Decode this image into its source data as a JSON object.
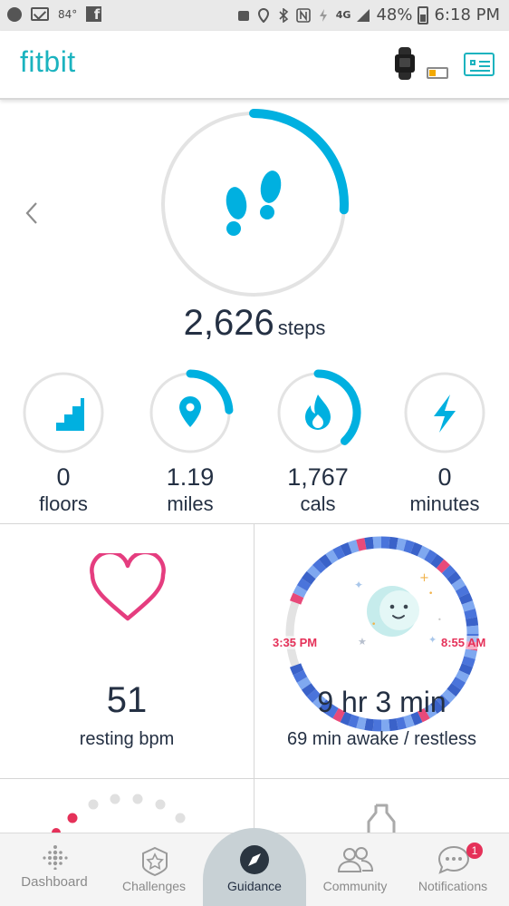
{
  "status_bar": {
    "temperature": "84°",
    "network": "4G",
    "battery": "48%",
    "time": "6:18 PM"
  },
  "header": {
    "logo": "fitbit"
  },
  "steps": {
    "value": "2,626",
    "unit": "steps",
    "progress": 0.26
  },
  "stats": [
    {
      "id": "floors",
      "value": "0",
      "label": "floors",
      "icon": "stairs-icon",
      "progress": 0
    },
    {
      "id": "miles",
      "value": "1.19",
      "label": "miles",
      "icon": "location-pin-icon",
      "progress": 0.24
    },
    {
      "id": "cals",
      "value": "1,767",
      "label": "cals",
      "icon": "flame-icon",
      "progress": 0.38
    },
    {
      "id": "minutes",
      "value": "0",
      "label": "minutes",
      "icon": "lightning-icon",
      "progress": 0
    }
  ],
  "heart": {
    "value": "51",
    "label": "resting bpm",
    "icon": "heart-icon"
  },
  "sleep": {
    "start_time": "3:35 PM",
    "end_time": "8:55 AM",
    "duration": "9 hr 3 min",
    "detail": "69 min awake / restless",
    "icon": "moon-icon"
  },
  "nav": {
    "items": [
      {
        "id": "dashboard",
        "label": "Dashboard",
        "icon": "dots-grid-icon"
      },
      {
        "id": "challenges",
        "label": "Challenges",
        "icon": "star-badge-icon"
      },
      {
        "id": "guidance",
        "label": "Guidance",
        "icon": "compass-icon"
      },
      {
        "id": "community",
        "label": "Community",
        "icon": "people-icon"
      },
      {
        "id": "notifications",
        "label": "Notifications",
        "icon": "chat-bubble-icon",
        "badge": "1"
      }
    ],
    "active": "guidance"
  },
  "colors": {
    "brand_teal": "#1bb3bf",
    "progress_blue": "#00b0e0",
    "heart_pink": "#e53d7f",
    "text_dark": "#243043",
    "ring_grey": "#e3e3e3"
  }
}
